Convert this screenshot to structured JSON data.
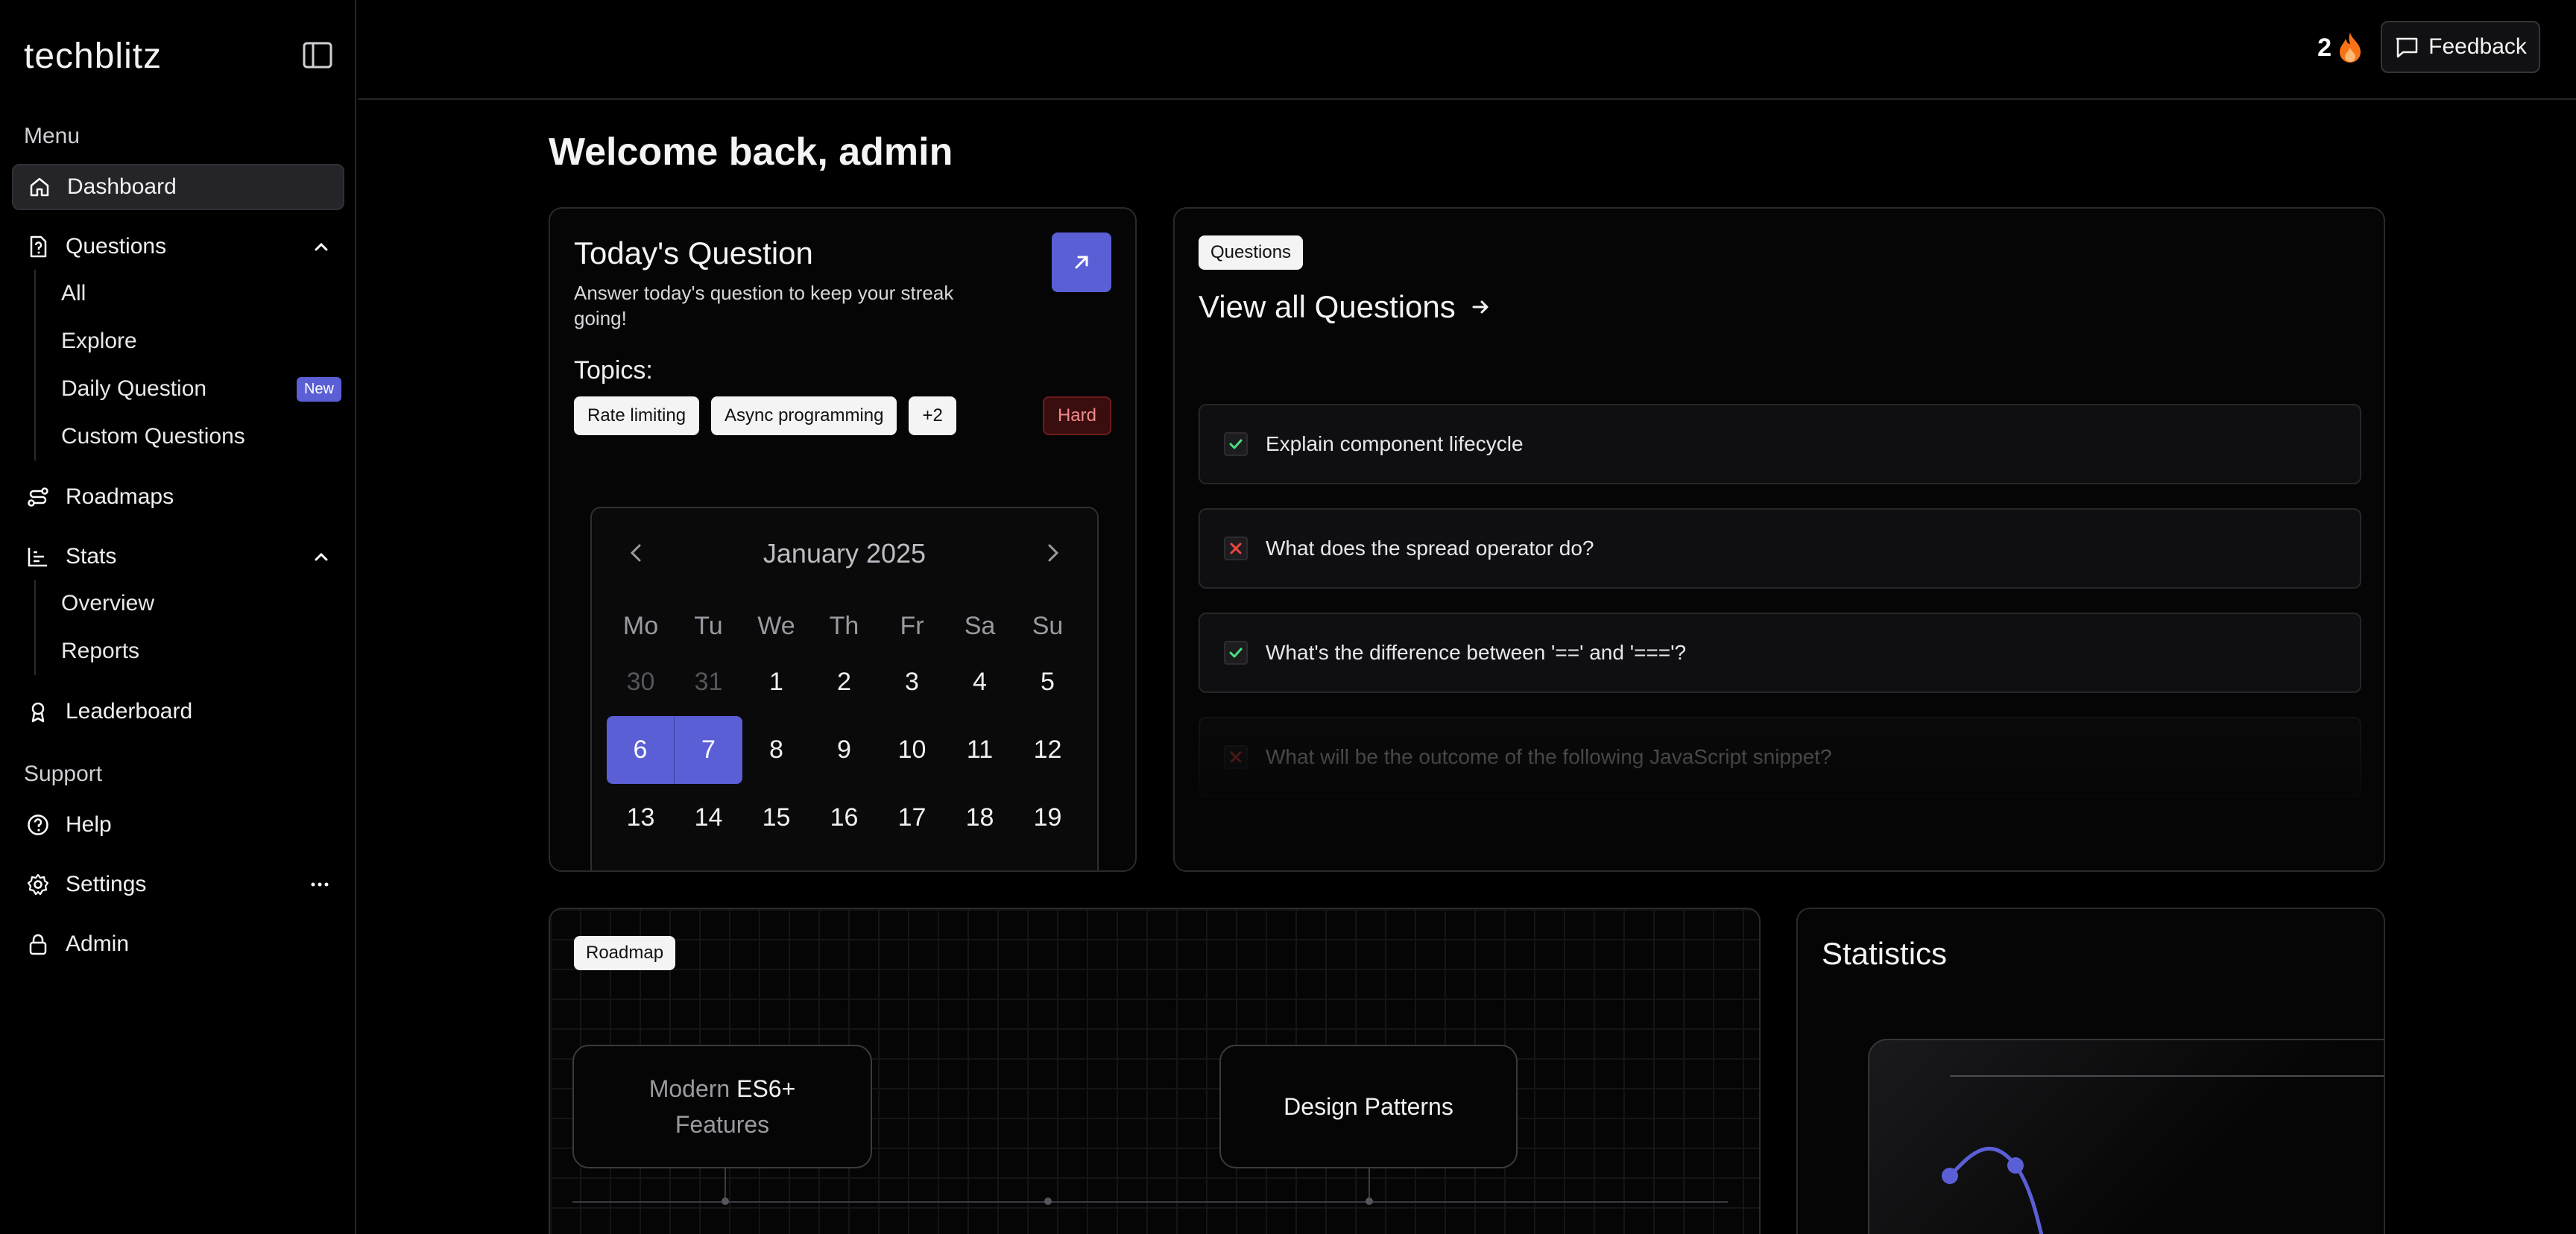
{
  "sidebar": {
    "logo": "techblitz",
    "menu_label": "Menu",
    "support_label": "Support",
    "dashboard": "Dashboard",
    "questions": "Questions",
    "questions_sub": [
      "All",
      "Explore",
      "Daily Question",
      "Custom Questions"
    ],
    "new_badge": "New",
    "roadmaps": "Roadmaps",
    "stats": "Stats",
    "stats_sub": [
      "Overview",
      "Reports"
    ],
    "leaderboard": "Leaderboard",
    "help": "Help",
    "settings": "Settings",
    "admin": "Admin"
  },
  "topbar": {
    "streak_count": "2",
    "feedback_label": "Feedback"
  },
  "welcome": "Welcome back, admin",
  "todays_question": {
    "title": "Today's Question",
    "description": "Answer today's question to keep your streak going!",
    "topics_label": "Topics:",
    "topics": [
      "Rate limiting",
      "Async programming",
      "+2"
    ],
    "difficulty": "Hard"
  },
  "calendar": {
    "month": "January 2025",
    "weekdays": [
      "Mo",
      "Tu",
      "We",
      "Th",
      "Fr",
      "Sa",
      "Su"
    ],
    "weeks": [
      [
        "30",
        "31",
        "1",
        "2",
        "3",
        "4",
        "5"
      ],
      [
        "6",
        "7",
        "8",
        "9",
        "10",
        "11",
        "12"
      ],
      [
        "13",
        "14",
        "15",
        "16",
        "17",
        "18",
        "19"
      ]
    ],
    "selected": [
      "6",
      "7"
    ]
  },
  "questions_card": {
    "tag": "Questions",
    "view_all": "View all Questions",
    "items": [
      {
        "text": "Explain component lifecycle",
        "status": "correct"
      },
      {
        "text": "What does the spread operator do?",
        "status": "incorrect"
      },
      {
        "text": "What's the difference between '==' and '==='?",
        "status": "correct"
      },
      {
        "text": "What will be the outcome of the following JavaScript snippet?",
        "status": "incorrect"
      }
    ]
  },
  "roadmap_card": {
    "tag": "Roadmap",
    "node1_dim": "Modern",
    "node1_rest": " ES6+",
    "node1_line2": "Features",
    "node2": "Design Patterns"
  },
  "statistics_card": {
    "title": "Statistics"
  },
  "colors": {
    "accent": "#5b5fd6",
    "correct": "#4ade80",
    "incorrect": "#ef4444",
    "hard_text": "#f08a8a"
  }
}
